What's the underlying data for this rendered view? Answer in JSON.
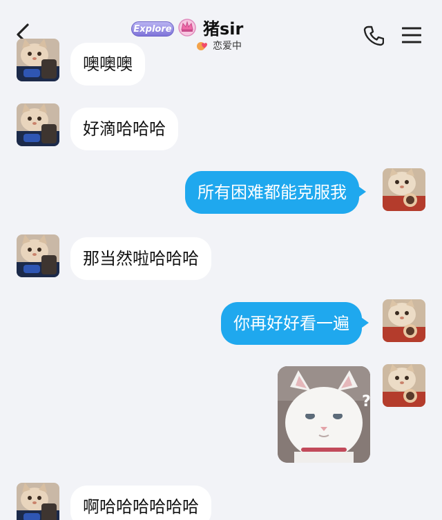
{
  "header": {
    "badge_text": "Explore",
    "contact_name": "猪sir",
    "status_text": "恋爱中"
  },
  "messages": [
    {
      "side": "in",
      "text": "噢噢噢"
    },
    {
      "side": "in",
      "text": "好滴哈哈哈"
    },
    {
      "side": "out",
      "text": "所有困难都能克服我"
    },
    {
      "side": "in",
      "text": "那当然啦哈哈哈"
    },
    {
      "side": "out",
      "text": "你再好好看一遍"
    },
    {
      "side": "out",
      "image": "white-cat-sticker"
    },
    {
      "side": "in",
      "text": "啊哈哈哈哈哈哈"
    }
  ],
  "colors": {
    "background": "#f2f3f7",
    "incoming_bubble": "#ffffff",
    "outgoing_bubble": "#1fa8ee"
  },
  "icons": [
    "back-arrow-icon",
    "crown-icon",
    "status-heart-icon",
    "phone-icon",
    "menu-icon"
  ]
}
